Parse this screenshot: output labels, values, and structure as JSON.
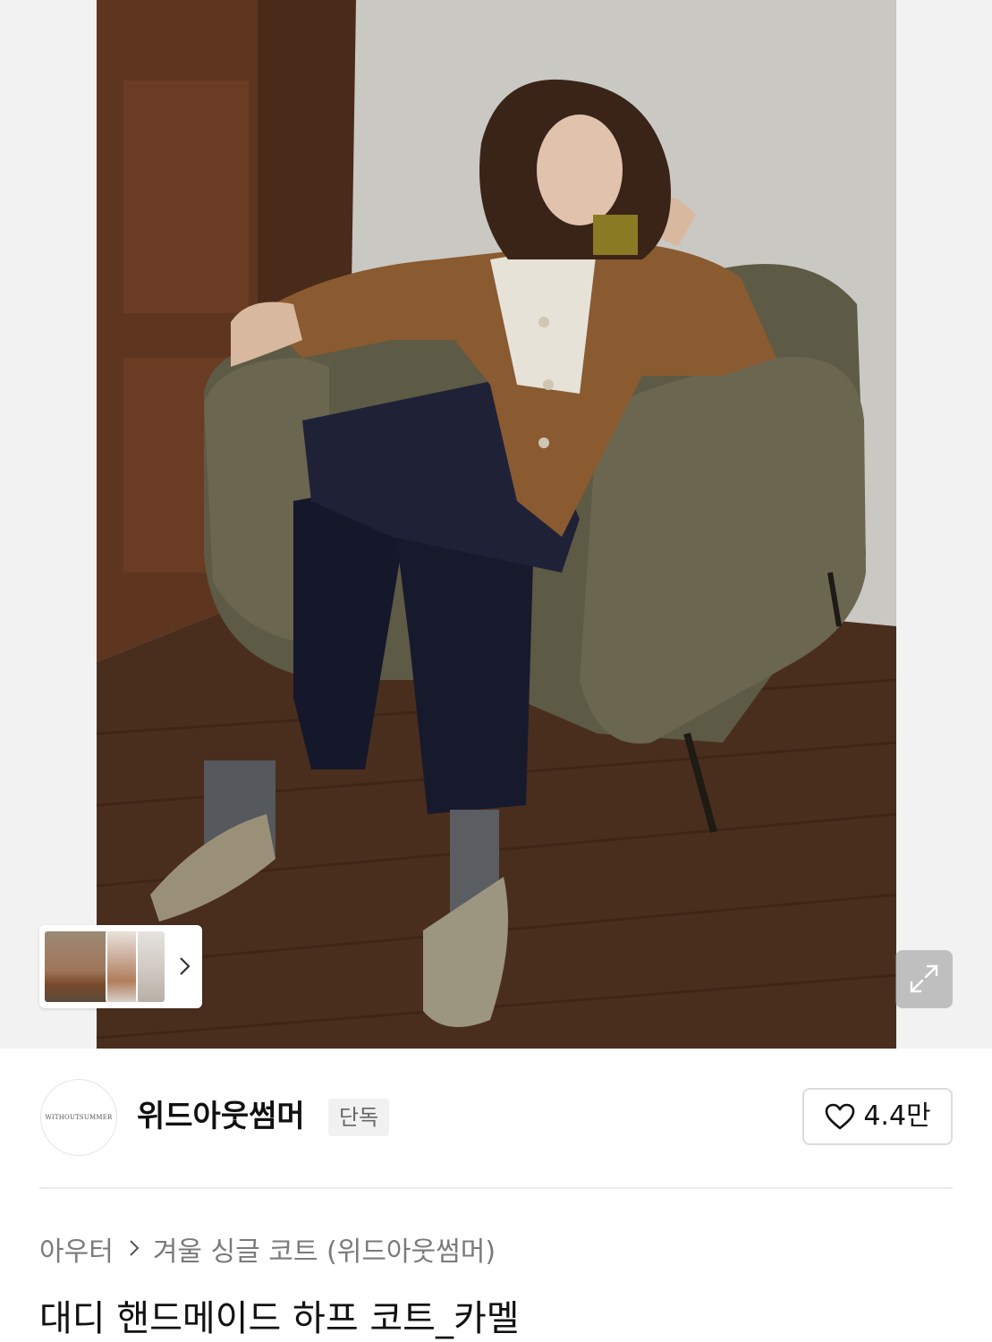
{
  "gallery": {
    "expand_icon": "expand-arrows-icon",
    "next_icon": "chevron-right-icon"
  },
  "brand": {
    "logo_text": "WITHOUTSUMMER",
    "name": "위드아웃썸머",
    "badge": "단독"
  },
  "like": {
    "icon": "heart-outline-icon",
    "count": "4.4만"
  },
  "breadcrumb": {
    "items": [
      "아우터",
      "겨울 싱글 코트 (위드아웃썸머)"
    ]
  },
  "product": {
    "title": "대디 핸드메이드 하프 코트_카멜"
  }
}
